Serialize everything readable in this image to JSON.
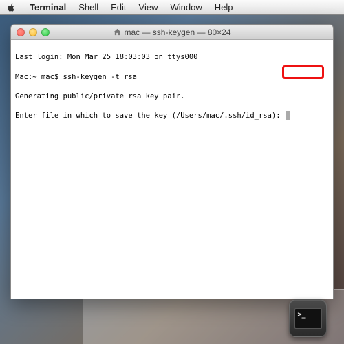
{
  "menubar": {
    "app": "Terminal",
    "items": [
      "Shell",
      "Edit",
      "View",
      "Window",
      "Help"
    ]
  },
  "window": {
    "title": "mac — ssh-keygen — 80×24"
  },
  "terminal": {
    "lines": [
      "Last login: Mon Mar 25 18:03:03 on ttys000",
      "Mac:~ mac$ ssh-keygen -t rsa",
      "Generating public/private rsa key pair.",
      "Enter file in which to save the key (/Users/mac/.ssh/id_rsa): "
    ]
  },
  "dock": {
    "icon": "terminal-app"
  }
}
